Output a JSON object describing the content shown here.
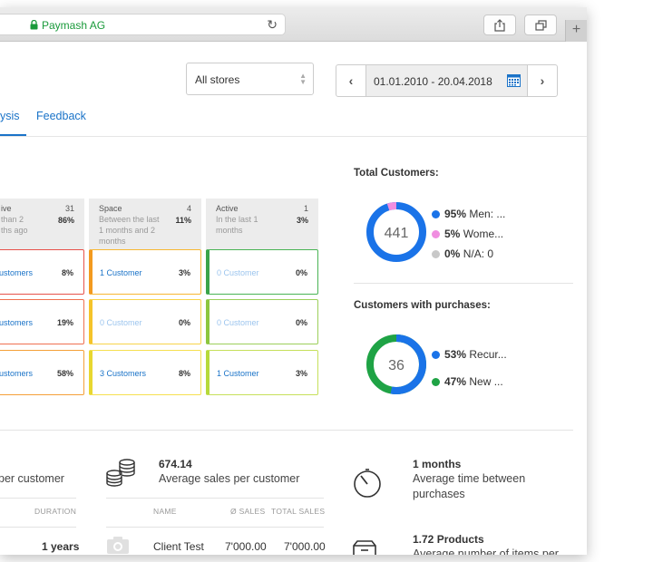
{
  "browser": {
    "url": "Paymash AG",
    "plus": "+"
  },
  "filters": {
    "store": "All stores",
    "date_range": "01.01.2010 - 20.04.2018",
    "prev": "‹",
    "next": "›"
  },
  "tabs": [
    {
      "label": "ysis"
    },
    {
      "label": "Feedback"
    }
  ],
  "segments": {
    "columns": [
      {
        "title": "ive",
        "desc1": "than 2",
        "desc2": "ths ago",
        "desc3": "",
        "count": "31",
        "pct": "86%"
      },
      {
        "title": "Space",
        "desc1": "Between the last",
        "desc2": "1 months and 2",
        "desc3": "months",
        "count": "4",
        "pct": "11%"
      },
      {
        "title": "Active",
        "desc1": "In the last 1",
        "desc2": "months",
        "desc3": "",
        "count": "1",
        "pct": "3%"
      }
    ],
    "rows": [
      [
        {
          "label": "ustomers",
          "pct": "8%"
        },
        {
          "label": "1 Customer",
          "pct": "3%"
        },
        {
          "label": "0 Customer",
          "pct": "0%"
        }
      ],
      [
        {
          "label": "ustomers",
          "pct": "19%"
        },
        {
          "label": "0 Customer",
          "pct": "0%"
        },
        {
          "label": "0 Customer",
          "pct": "0%"
        }
      ],
      [
        {
          "label": "ustomers",
          "pct": "58%"
        },
        {
          "label": "3 Customers",
          "pct": "8%"
        },
        {
          "label": "1 Customer",
          "pct": "3%"
        }
      ]
    ]
  },
  "total_customers": {
    "title": "Total Customers:",
    "center": "441",
    "legend": [
      {
        "pct": "95%",
        "label": "Men: ...",
        "color": "#1a73e8",
        "value": 95
      },
      {
        "pct": "5%",
        "label": "Wome...",
        "color": "#f08ee0",
        "value": 5
      },
      {
        "pct": "0%",
        "label": "N/A: 0",
        "color": "#c8c8c8",
        "value": 0
      }
    ]
  },
  "customers_with_purchases": {
    "title": "Customers with purchases:",
    "center": "36",
    "legend": [
      {
        "pct": "53%",
        "label": "Recur...",
        "color": "#1a73e8",
        "value": 53
      },
      {
        "pct": "47%",
        "label": "New ...",
        "color": "#1fa345",
        "value": 47
      }
    ]
  },
  "stats": {
    "col1": {
      "label": "per customer",
      "th_duration": "DURATION",
      "row_value": "1 years"
    },
    "col2": {
      "value": "674.14",
      "label": "Average sales per customer",
      "th_name": "NAME",
      "th_avg": "Ø SALES",
      "th_total": "TOTAL SALES",
      "row_name": "Client Test",
      "row_avg": "7'000.00",
      "row_total": "7'000.00"
    },
    "col3": {
      "value": "1 months",
      "label1": "Average time between",
      "label2": "purchases",
      "value2": "1.72 Products",
      "label3": "Average number of items per"
    }
  }
}
